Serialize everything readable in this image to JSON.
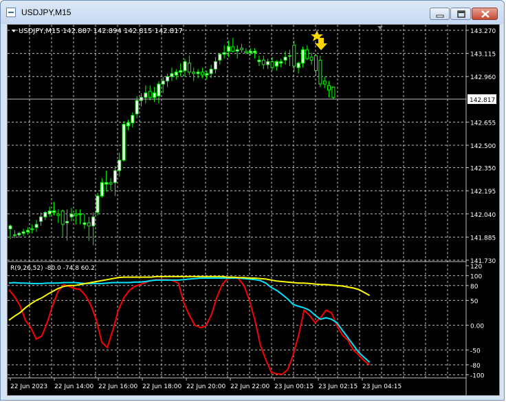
{
  "window": {
    "title": "USDJPY,M15",
    "icon": "chart-window-icon",
    "controls": [
      "minimize-icon",
      "maximize-icon",
      "close-icon"
    ]
  },
  "chart": {
    "header": "USDJPY,M15  142.887 142.894 142.815 142.817",
    "symbol": "USDJPY",
    "timeframe": "M15",
    "ohlc": {
      "open": 142.887,
      "high": 142.894,
      "low": 142.815,
      "close": 142.817
    },
    "current_price_label": "142.817",
    "price_ticks": [
      "143.270",
      "143.115",
      "142.960",
      "142.817",
      "142.655",
      "142.500",
      "142.350",
      "142.195",
      "142.040",
      "141.885",
      "141.730"
    ],
    "indicator_header": "R(9,26,52) -80.0 -74.8 60.2",
    "indicator_ticks": [
      "120",
      "100",
      "80",
      "50",
      "0.00",
      "-50",
      "-80",
      "-100"
    ],
    "time_labels": [
      "22 Jun 2023",
      "22 Jun 14:00",
      "22 Jun 16:00",
      "22 Jun 18:00",
      "22 Jun 20:00",
      "22 Jun 22:00",
      "23 Jun 00:15",
      "23 Jun 02:15",
      "23 Jun 04:15"
    ],
    "colors": {
      "background": "#000000",
      "grid": "#c0c0c0",
      "bull_candle": "#ffffff",
      "bear_candle": "#000000",
      "wick": "#00ff00",
      "red_line": "#ff0000",
      "cyan_line": "#00e5ff",
      "yellow_line": "#ffff00",
      "arrow": "#ffd700",
      "star": "#ffd700"
    },
    "annotations": {
      "star_icon": "star-icon",
      "arrow_icon": "arrow-down-icon"
    }
  },
  "chart_data": [
    {
      "type": "candlestick",
      "title": "USDJPY,M15",
      "ylim": [
        141.73,
        143.27
      ],
      "candles": [
        [
          141.94,
          141.97,
          141.87,
          141.96
        ],
        [
          141.9,
          141.93,
          141.88,
          141.9
        ],
        [
          141.9,
          141.92,
          141.88,
          141.91
        ],
        [
          141.91,
          141.94,
          141.89,
          141.92
        ],
        [
          141.92,
          141.95,
          141.9,
          141.93
        ],
        [
          141.94,
          141.97,
          141.91,
          141.94
        ],
        [
          141.95,
          142.0,
          141.92,
          141.97
        ],
        [
          141.99,
          142.05,
          141.96,
          142.02
        ],
        [
          142.02,
          142.06,
          142.0,
          142.05
        ],
        [
          142.04,
          142.09,
          142.02,
          142.06
        ],
        [
          142.05,
          142.12,
          142.03,
          142.06
        ],
        [
          142.04,
          142.07,
          141.98,
          142.03
        ],
        [
          142.06,
          142.07,
          141.89,
          141.97
        ],
        [
          141.98,
          142.07,
          141.86,
          141.99
        ],
        [
          142.02,
          142.08,
          141.99,
          142.04
        ],
        [
          142.04,
          142.07,
          141.97,
          142.03
        ],
        [
          142.04,
          142.07,
          141.97,
          142.04
        ],
        [
          141.97,
          142.04,
          141.94,
          141.98
        ],
        [
          141.98,
          142.02,
          141.86,
          141.96
        ],
        [
          141.96,
          142.05,
          141.83,
          142.02
        ],
        [
          142.05,
          142.18,
          142.03,
          142.16
        ],
        [
          142.16,
          142.28,
          142.15,
          142.25
        ],
        [
          142.24,
          142.33,
          142.19,
          142.25
        ],
        [
          142.25,
          142.28,
          142.2,
          142.24
        ],
        [
          142.25,
          142.36,
          142.16,
          142.33
        ],
        [
          142.33,
          142.45,
          142.29,
          142.4
        ],
        [
          142.4,
          142.66,
          142.39,
          142.64
        ],
        [
          142.63,
          142.67,
          142.6,
          142.65
        ],
        [
          142.65,
          142.72,
          142.62,
          142.7
        ],
        [
          142.71,
          142.83,
          142.68,
          142.8
        ],
        [
          142.8,
          142.85,
          142.76,
          142.82
        ],
        [
          142.82,
          142.9,
          142.78,
          142.85
        ],
        [
          142.86,
          142.9,
          142.8,
          142.82
        ],
        [
          142.82,
          142.89,
          142.79,
          142.85
        ],
        [
          142.83,
          142.93,
          142.78,
          142.91
        ],
        [
          142.91,
          142.96,
          142.85,
          142.93
        ],
        [
          142.93,
          142.98,
          142.89,
          142.96
        ],
        [
          142.96,
          143.02,
          142.93,
          142.98
        ],
        [
          142.97,
          143.01,
          142.94,
          142.99
        ],
        [
          142.99,
          143.05,
          142.96,
          143.0
        ],
        [
          143.0,
          143.08,
          142.96,
          143.06
        ],
        [
          143.05,
          143.1,
          142.97,
          142.99
        ],
        [
          142.99,
          143.02,
          142.93,
          142.98
        ],
        [
          142.98,
          143.01,
          142.95,
          142.99
        ],
        [
          142.99,
          143.02,
          142.95,
          142.97
        ],
        [
          142.97,
          143.0,
          142.94,
          142.98
        ],
        [
          142.98,
          143.04,
          142.95,
          143.01
        ],
        [
          143.01,
          143.09,
          142.98,
          143.06
        ],
        [
          143.07,
          143.12,
          143.04,
          143.11
        ],
        [
          143.11,
          143.17,
          143.08,
          143.12
        ],
        [
          143.13,
          143.2,
          143.09,
          143.16
        ],
        [
          143.16,
          143.22,
          143.12,
          143.13
        ],
        [
          143.13,
          143.17,
          143.08,
          143.14
        ],
        [
          143.15,
          143.18,
          143.12,
          143.14
        ],
        [
          143.13,
          143.15,
          143.11,
          143.12
        ],
        [
          143.12,
          143.15,
          143.1,
          143.13
        ],
        [
          143.12,
          143.15,
          143.08,
          143.13
        ],
        [
          143.06,
          143.1,
          143.03,
          143.07
        ],
        [
          143.07,
          143.1,
          143.01,
          143.04
        ],
        [
          143.04,
          143.08,
          143.01,
          143.06
        ],
        [
          143.06,
          143.09,
          143.0,
          143.02
        ],
        [
          143.03,
          143.07,
          143.0,
          143.06
        ],
        [
          143.05,
          143.08,
          143.02,
          143.06
        ],
        [
          143.07,
          143.13,
          143.04,
          143.09
        ],
        [
          143.1,
          143.14,
          143.03,
          143.1
        ],
        [
          143.17,
          143.2,
          142.99,
          143.03
        ],
        [
          143.02,
          143.06,
          142.98,
          143.05
        ],
        [
          143.05,
          143.16,
          143.02,
          143.14
        ],
        [
          143.14,
          143.17,
          143.07,
          143.08
        ],
        [
          143.09,
          143.12,
          143.04,
          143.07
        ],
        [
          143.1,
          143.11,
          142.97,
          143.0
        ],
        [
          143.07,
          143.1,
          142.89,
          142.91
        ],
        [
          142.93,
          142.96,
          142.88,
          142.91
        ],
        [
          142.9,
          142.93,
          142.82,
          142.87
        ],
        [
          142.89,
          142.89,
          142.81,
          142.82
        ]
      ],
      "price_label": 142.817
    },
    {
      "type": "line",
      "title": "R(9,26,52)",
      "ylim": [
        -105,
        120
      ],
      "series": [
        {
          "name": "R(9)",
          "values": [
            72,
            58,
            40,
            10,
            -5,
            -28,
            -22,
            5,
            40,
            68,
            82,
            78,
            74,
            72,
            60,
            40,
            10,
            -35,
            -45,
            -10,
            30,
            55,
            70,
            78,
            82,
            86,
            90,
            92,
            92,
            92,
            90,
            85,
            45,
            20,
            0,
            -5,
            -2,
            20,
            55,
            82,
            94,
            96,
            94,
            80,
            50,
            10,
            -40,
            -70,
            -95,
            -98,
            -99,
            -90,
            -60,
            -20,
            30,
            20,
            5,
            15,
            30,
            25,
            0,
            -20,
            -30,
            -50,
            -60,
            -72,
            -80
          ]
        },
        {
          "name": "R(26)",
          "values": [
            85,
            86,
            85,
            85,
            84,
            84,
            84,
            85,
            85,
            85,
            86,
            86,
            86,
            85,
            84,
            84,
            84,
            84,
            85,
            86,
            86,
            86,
            86,
            87,
            87,
            88,
            90,
            91,
            91,
            91,
            91,
            91,
            92,
            93,
            94,
            95,
            95,
            95,
            95,
            95,
            95,
            95,
            95,
            94,
            93,
            92,
            90,
            85,
            76,
            70,
            62,
            53,
            42,
            38,
            35,
            30,
            20,
            12,
            15,
            12,
            5,
            -10,
            -25,
            -40,
            -55,
            -65,
            -75
          ]
        },
        {
          "name": "R(52)",
          "values": [
            10,
            18,
            25,
            35,
            43,
            50,
            55,
            62,
            68,
            74,
            78,
            80,
            80,
            82,
            84,
            86,
            88,
            90,
            92,
            94,
            96,
            97,
            97,
            97,
            97,
            97,
            97,
            98,
            98,
            98,
            98,
            98,
            98,
            98,
            98,
            98,
            98,
            98,
            98,
            98,
            97,
            97,
            96,
            96,
            95,
            95,
            94,
            93,
            91,
            89,
            88,
            87,
            86,
            85,
            85,
            84,
            83,
            82,
            82,
            81,
            80,
            79,
            77,
            75,
            72,
            66,
            60
          ]
        }
      ]
    }
  ]
}
